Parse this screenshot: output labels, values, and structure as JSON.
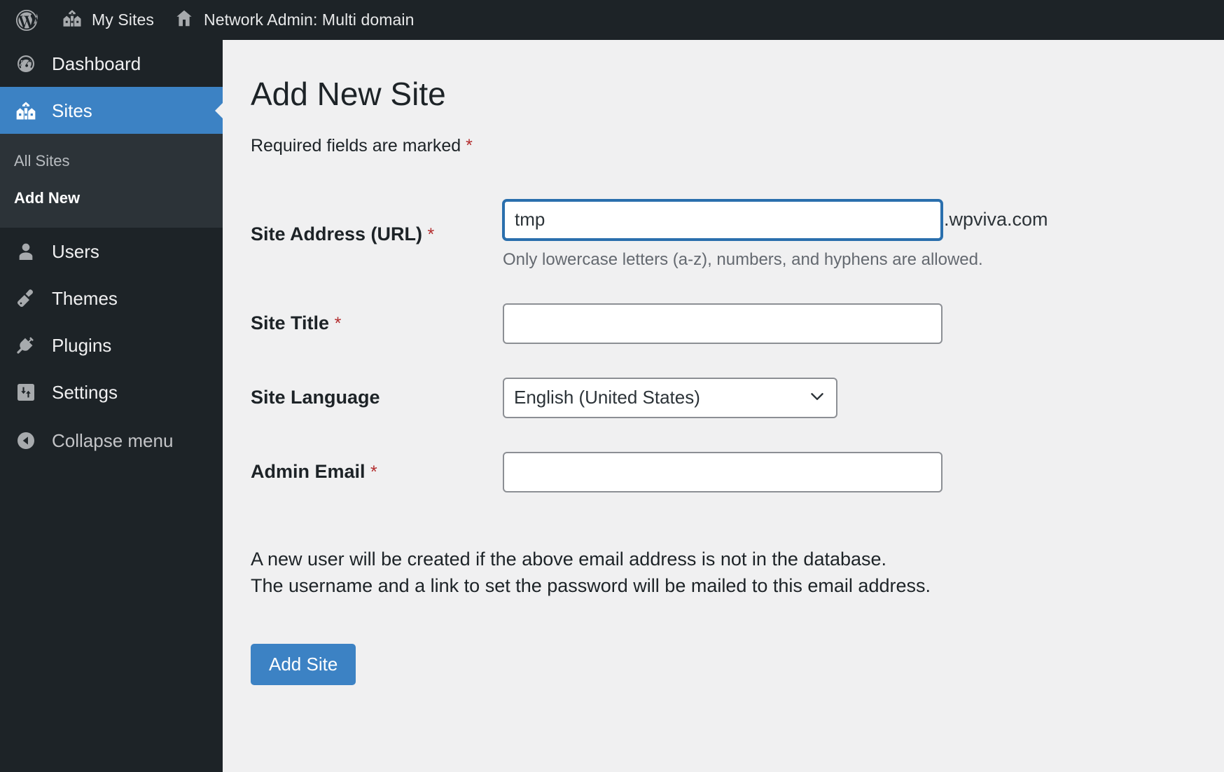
{
  "adminbar": {
    "logo_icon": "wordpress-logo-icon",
    "items": [
      {
        "icon": "my-sites-icon",
        "label": "My Sites"
      },
      {
        "icon": "network-home-icon",
        "label": "Network Admin: Multi domain"
      }
    ]
  },
  "sidebar": {
    "items": [
      {
        "icon": "dashboard-icon",
        "label": "Dashboard",
        "current": false
      },
      {
        "icon": "sites-icon",
        "label": "Sites",
        "current": true
      },
      {
        "icon": "users-icon",
        "label": "Users",
        "current": false
      },
      {
        "icon": "themes-icon",
        "label": "Themes",
        "current": false
      },
      {
        "icon": "plugins-icon",
        "label": "Plugins",
        "current": false
      },
      {
        "icon": "settings-icon",
        "label": "Settings",
        "current": false
      }
    ],
    "submenu": [
      {
        "label": "All Sites",
        "current": false
      },
      {
        "label": "Add New",
        "current": true
      }
    ],
    "collapse": {
      "icon": "collapse-arrow-icon",
      "label": "Collapse menu"
    },
    "highlight_color": "#3c82c4",
    "background_color": "#1d2327",
    "submenu_background_color": "#2c3338"
  },
  "main": {
    "page_title": "Add New Site",
    "required_note": "Required fields are marked",
    "required_marker": "*",
    "fields": {
      "site_address": {
        "label": "Site Address (URL)",
        "required": true,
        "value": "tmp",
        "placeholder": "",
        "domain_suffix": ".wpviva.com",
        "help": "Only lowercase letters (a-z), numbers, and hyphens are allowed.",
        "focused": true
      },
      "site_title": {
        "label": "Site Title",
        "required": true,
        "value": "",
        "placeholder": ""
      },
      "site_language": {
        "label": "Site Language",
        "required": false,
        "selected": "English (United States)",
        "caret_icon": "chevron-down-icon"
      },
      "admin_email": {
        "label": "Admin Email",
        "required": true,
        "value": "",
        "placeholder": ""
      }
    },
    "info_line_1": "A new user will be created if the above email address is not in the database.",
    "info_line_2": "The username and a link to set the password will be mailed to this email address.",
    "submit_label": "Add Site",
    "accent_color": "#3c82c4",
    "required_color": "#b32d2e"
  }
}
